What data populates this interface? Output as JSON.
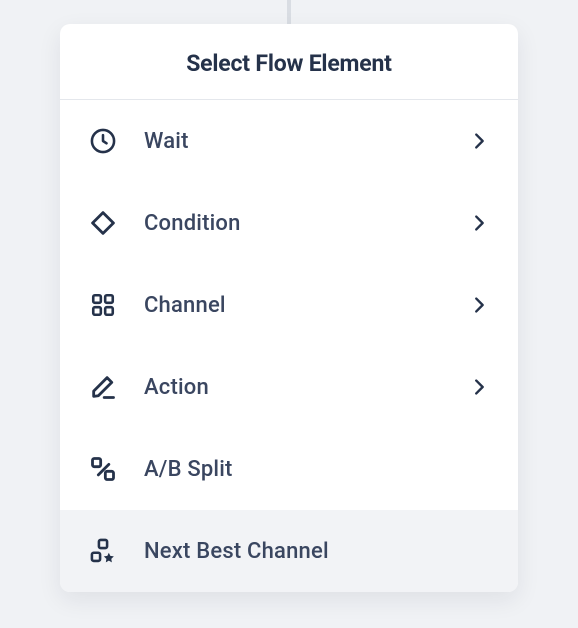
{
  "modal": {
    "title": "Select Flow Element",
    "items": [
      {
        "icon": "clock-icon",
        "label": "Wait",
        "has_submenu": true
      },
      {
        "icon": "diamond-icon",
        "label": "Condition",
        "has_submenu": true
      },
      {
        "icon": "grid-icon",
        "label": "Channel",
        "has_submenu": true
      },
      {
        "icon": "edit-icon",
        "label": "Action",
        "has_submenu": true
      },
      {
        "icon": "absplit-icon",
        "label": "A/B Split",
        "has_submenu": false
      },
      {
        "icon": "nextbest-icon",
        "label": "Next Best Channel",
        "has_submenu": false,
        "hover": true
      }
    ]
  }
}
